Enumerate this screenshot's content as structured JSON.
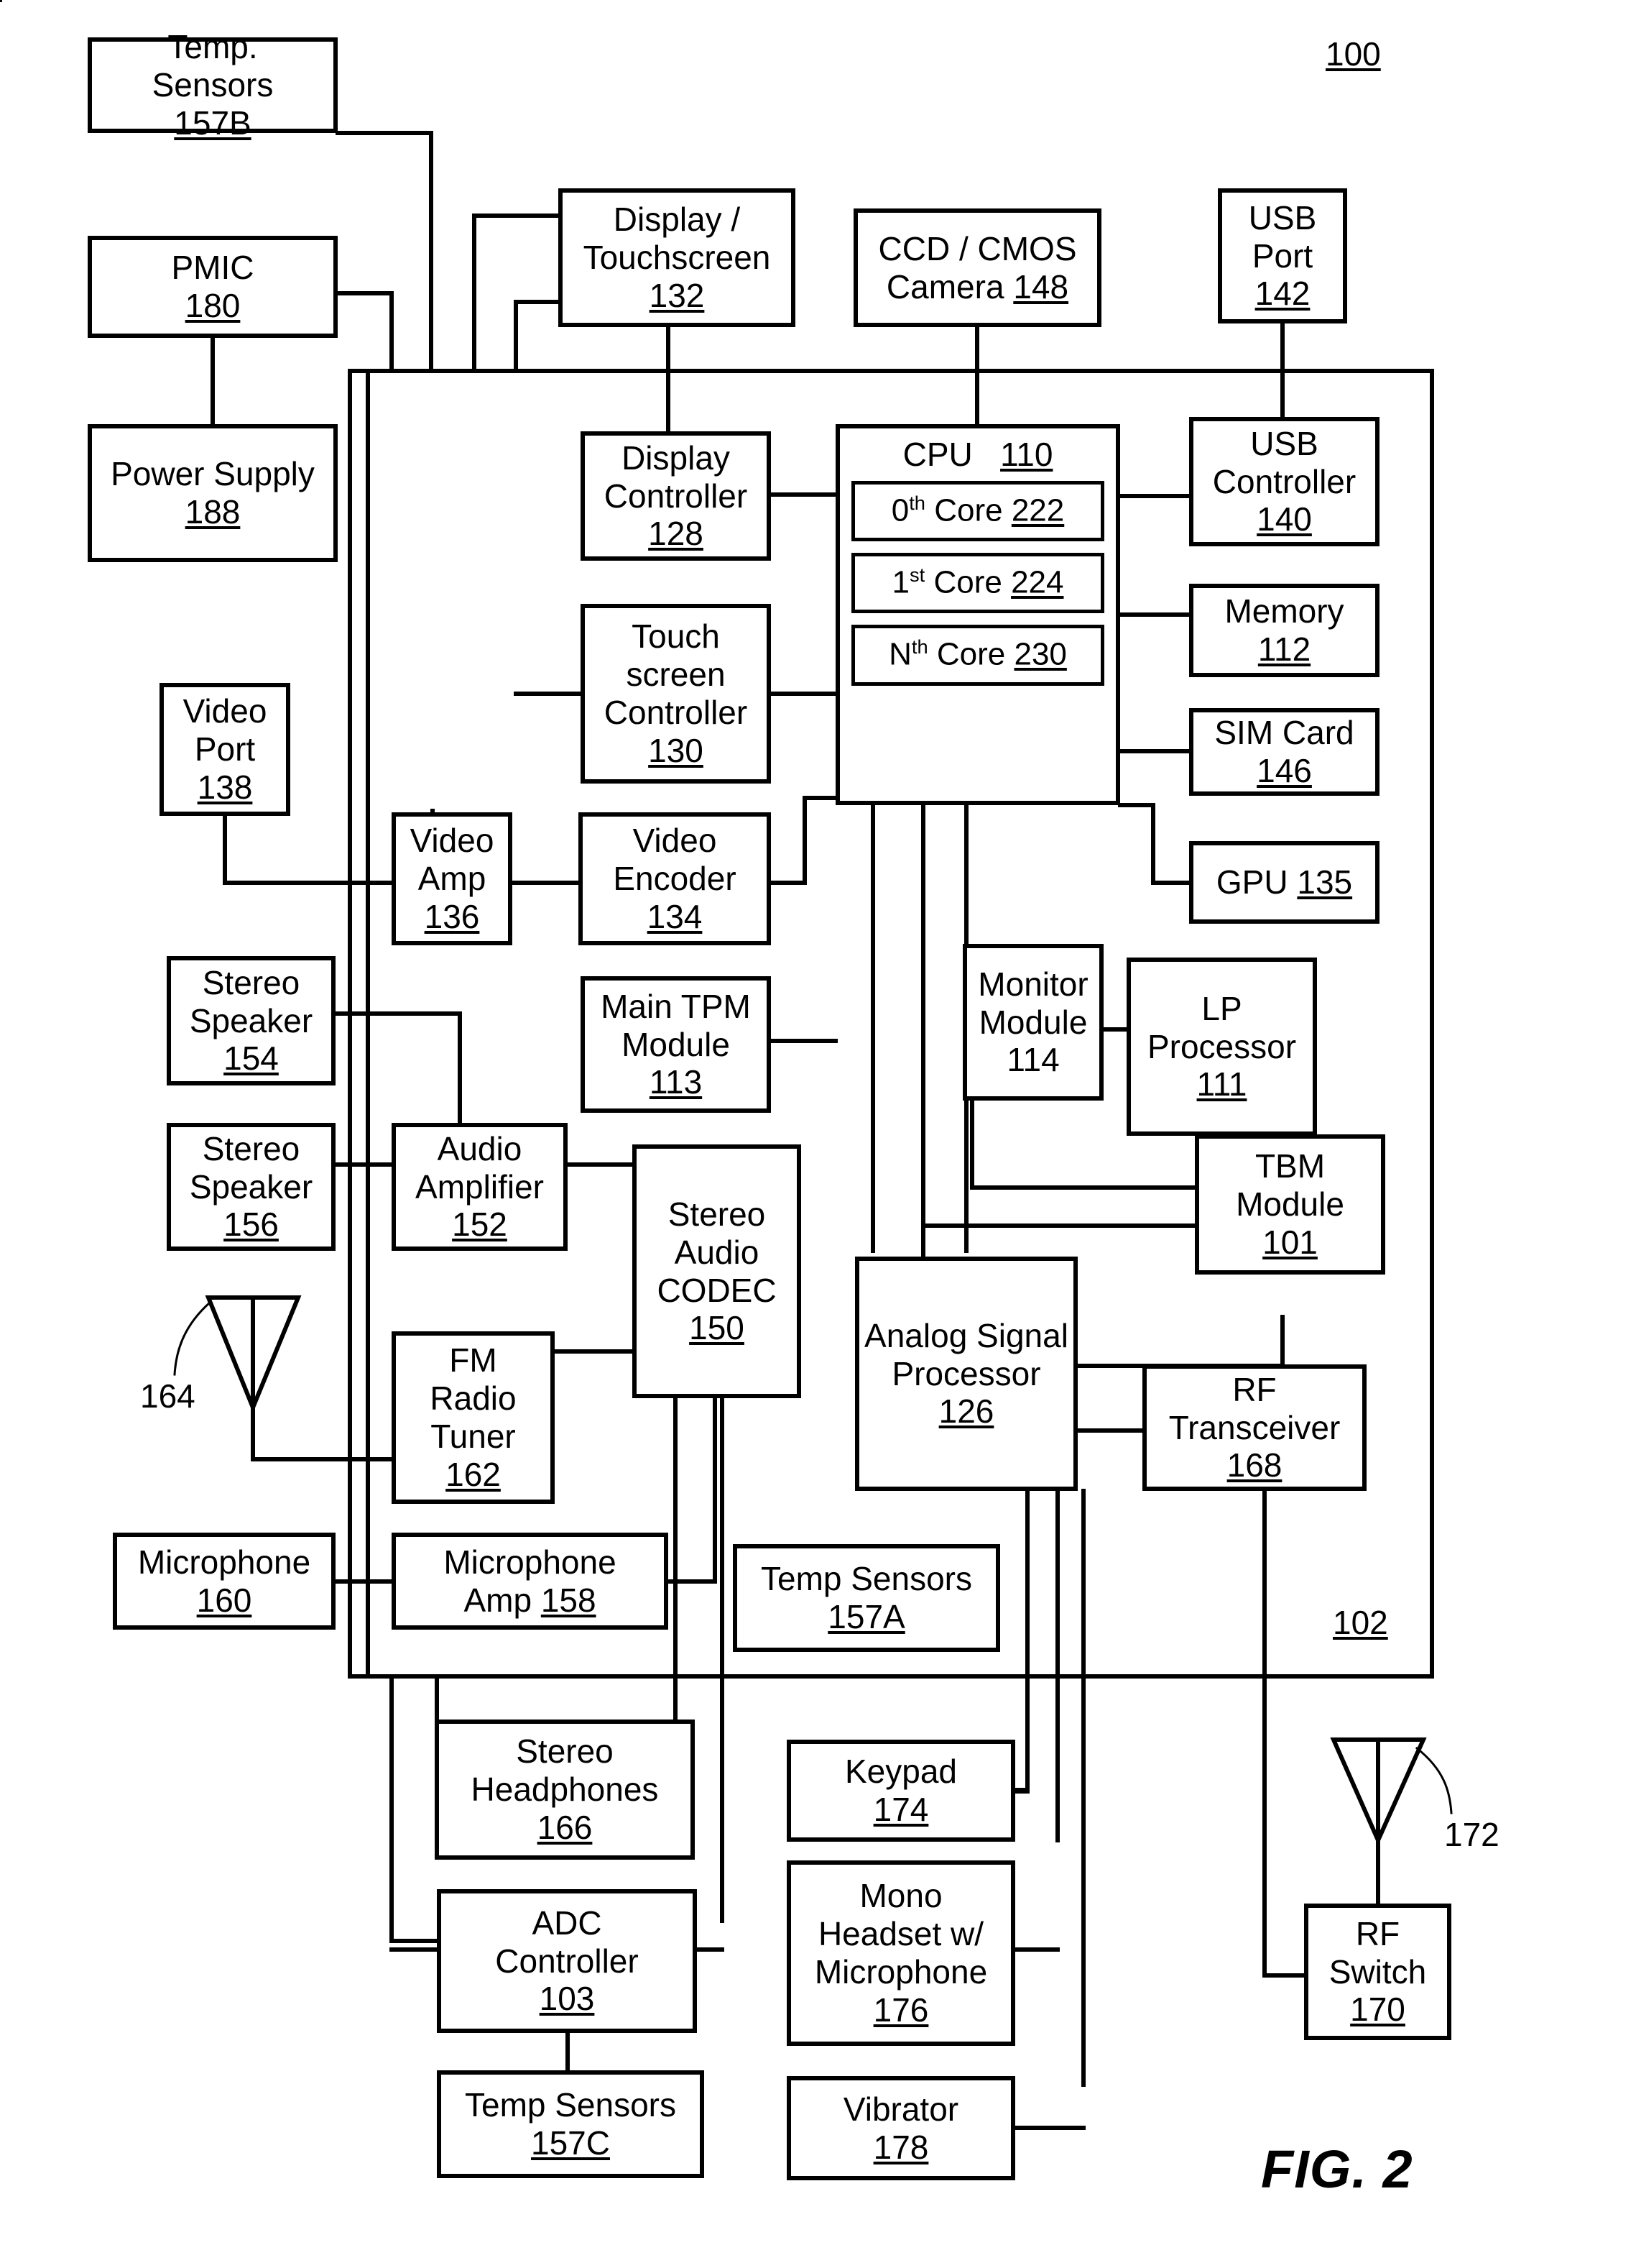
{
  "figure": {
    "caption": "FIG. 2",
    "system_ref": "100",
    "chip_ref": "102",
    "antenna_fm_ref": "164",
    "antenna_rf_ref": "172"
  },
  "blocks": {
    "temp_sensors_157b": {
      "lines": [
        "Temp.",
        "Sensors"
      ],
      "ref": "157B",
      "ref_underlined": true
    },
    "pmic_180": {
      "lines": [
        "PMIC"
      ],
      "ref": "180",
      "ref_underlined": true
    },
    "power_supply_188": {
      "lines": [
        "Power Supply"
      ],
      "ref": "188",
      "ref_underlined": true
    },
    "display_touchscreen_132": {
      "lines": [
        "Display /",
        "Touchscreen"
      ],
      "ref": "132",
      "ref_underlined": true
    },
    "ccd_cmos_camera_148": {
      "lines": [
        "CCD / CMOS"
      ],
      "inline_line": "Camera",
      "ref": "148",
      "ref_underlined": true
    },
    "usb_port_142": {
      "lines": [
        "USB",
        "Port"
      ],
      "ref": "142",
      "ref_underlined": true
    },
    "display_controller_128": {
      "lines": [
        "Display",
        "Controller"
      ],
      "ref": "128",
      "ref_underlined": true
    },
    "cpu_110": {
      "title": "CPU",
      "ref": "110",
      "ref_underlined": true,
      "cores": [
        {
          "ordinal": "0",
          "suffix": "th",
          "label": "Core",
          "ref": "222",
          "ref_underlined": true
        },
        {
          "ordinal": "1",
          "suffix": "st",
          "label": "Core",
          "ref": "224",
          "ref_underlined": true
        },
        {
          "ordinal": "N",
          "suffix": "th",
          "label": "Core",
          "ref": "230",
          "ref_underlined": true
        }
      ]
    },
    "usb_controller_140": {
      "lines": [
        "USB",
        "Controller"
      ],
      "ref": "140",
      "ref_underlined": true
    },
    "memory_112": {
      "lines": [
        "Memory"
      ],
      "ref": "112",
      "ref_underlined": true
    },
    "sim_card_146": {
      "lines": [
        "SIM Card"
      ],
      "ref": "146",
      "ref_underlined": true
    },
    "gpu_135": {
      "inline_line": "GPU",
      "ref": "135",
      "ref_underlined": true
    },
    "touch_screen_controller_130": {
      "lines": [
        "Touch",
        "screen",
        "Controller"
      ],
      "ref": "130",
      "ref_underlined": true
    },
    "video_port_138": {
      "lines": [
        "Video",
        "Port"
      ],
      "ref": "138",
      "ref_underlined": true
    },
    "video_amp_136": {
      "lines": [
        "Video",
        "Amp"
      ],
      "ref": "136",
      "ref_underlined": true
    },
    "video_encoder_134": {
      "lines": [
        "Video",
        "Encoder"
      ],
      "ref": "134",
      "ref_underlined": true
    },
    "monitor_module_114": {
      "lines": [
        "Monitor",
        "Module"
      ],
      "ref": "114",
      "ref_underlined": false
    },
    "lp_processor_111": {
      "lines": [
        "LP",
        "Processor"
      ],
      "ref": "111",
      "ref_underlined": true
    },
    "stereo_speaker_154": {
      "lines": [
        "Stereo",
        "Speaker"
      ],
      "ref": "154",
      "ref_underlined": true
    },
    "main_tpm_module_113": {
      "lines": [
        "Main TPM",
        "Module"
      ],
      "ref": "113",
      "ref_underlined": true
    },
    "tbm_module_101": {
      "lines": [
        "TBM",
        "Module"
      ],
      "ref": "101",
      "ref_underlined": true
    },
    "stereo_speaker_156": {
      "lines": [
        "Stereo",
        "Speaker"
      ],
      "ref": "156",
      "ref_underlined": true
    },
    "audio_amplifier_152": {
      "lines": [
        "Audio",
        "Amplifier"
      ],
      "ref": "152",
      "ref_underlined": true
    },
    "stereo_audio_codec_150": {
      "lines": [
        "Stereo",
        "Audio",
        "CODEC"
      ],
      "ref": "150",
      "ref_underlined": true
    },
    "analog_signal_processor_126": {
      "lines": [
        "Analog Signal",
        "Processor"
      ],
      "ref": "126",
      "ref_underlined": true
    },
    "rf_transceiver_168": {
      "lines": [
        "RF",
        "Transceiver"
      ],
      "ref": "168",
      "ref_underlined": true
    },
    "fm_radio_tuner_162": {
      "lines": [
        "FM",
        "Radio",
        "Tuner"
      ],
      "ref": "162",
      "ref_underlined": true
    },
    "microphone_160": {
      "lines": [
        "Microphone"
      ],
      "ref": "160",
      "ref_underlined": true
    },
    "microphone_amp_158": {
      "lines": [
        "Microphone"
      ],
      "inline_line": "Amp",
      "ref": "158",
      "ref_underlined": true
    },
    "temp_sensors_157a": {
      "lines": [
        "Temp Sensors"
      ],
      "ref": "157A",
      "ref_underlined": true
    },
    "stereo_headphones_166": {
      "lines": [
        "Stereo",
        "Headphones"
      ],
      "ref": "166",
      "ref_underlined": true
    },
    "keypad_174": {
      "lines": [
        "Keypad"
      ],
      "ref": "174",
      "ref_underlined": true
    },
    "adc_controller_103": {
      "lines": [
        "ADC",
        "Controller"
      ],
      "ref": "103",
      "ref_underlined": true
    },
    "mono_headset_mic_176": {
      "lines": [
        "Mono",
        "Headset w/",
        "Microphone"
      ],
      "ref": "176",
      "ref_underlined": true
    },
    "rf_switch_170": {
      "lines": [
        "RF",
        "Switch"
      ],
      "ref": "170",
      "ref_underlined": true
    },
    "temp_sensors_157c": {
      "lines": [
        "Temp Sensors"
      ],
      "ref": "157C",
      "ref_underlined": true
    },
    "vibrator_178": {
      "lines": [
        "Vibrator"
      ],
      "ref": "178",
      "ref_underlined": true
    }
  }
}
